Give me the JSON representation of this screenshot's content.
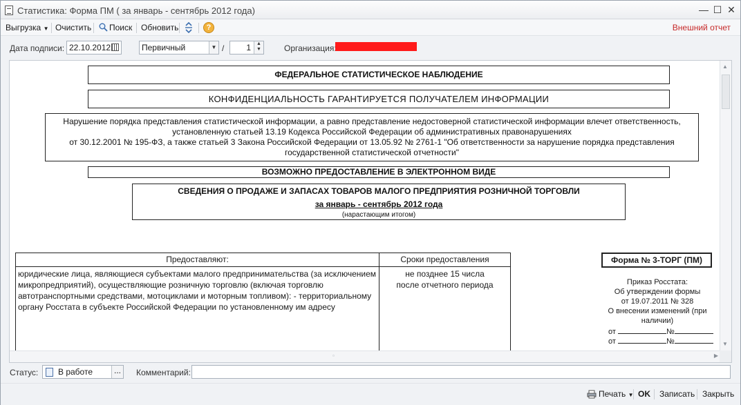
{
  "window": {
    "title": "Статистика: Форма ПМ ( за январь - сентябрь 2012 года)",
    "minimize": "—",
    "maximize": "☐",
    "close": "✕"
  },
  "toolbar": {
    "export_label": "Выгрузка",
    "clear_label": "Очистить",
    "search_label": "Поиск",
    "refresh_label": "Обновить",
    "help_glyph": "?",
    "external_report_label": "Внешний отчет",
    "external_report_color": "#c62828"
  },
  "header": {
    "sign_date_label": "Дата подписи:",
    "sign_date_value": "22.10.2012",
    "report_type_value": "Первичный",
    "slash": "/",
    "correction_value": "1",
    "organization_label": "Организация:"
  },
  "document": {
    "federal_title": "ФЕДЕРАЛЬНОЕ СТАТИСТИЧЕСКОЕ НАБЛЮДЕНИЕ",
    "confidential": "КОНФИДЕНЦИАЛЬНОСТЬ  ГАРАНТИРУЕТСЯ   ПОЛУЧАТЕЛЕМ   ИНФОРМАЦИИ",
    "warning_lines": [
      "Нарушение порядка представления статистической информации, а равно представление недостоверной статистической информации влечет ответственность,",
      "установленную статьей 13.19 Кодекса Российской Федерации об административных правонарушениях",
      "от 30.12.2001 № 195-ФЗ, а также статьей 3 Закона Российской Федерации от 13.05.92 № 2761-1 \"Об ответственности за нарушение порядка представления",
      "государственной статистической отчетности\""
    ],
    "electronic": "ВОЗМОЖНО ПРЕДОСТАВЛЕНИЕ В ЭЛЕКТРОННОМ ВИДЕ",
    "report_title": "СВЕДЕНИЯ О ПРОДАЖЕ И ЗАПАСАХ ТОВАРОВ МАЛОГО ПРЕДПРИЯТИЯ РОЗНИЧНОЙ ТОРГОВЛИ",
    "period": "за январь - сентябрь 2012 года",
    "cumulative": "(нарастающим итогом)",
    "table": {
      "col_who": "Предоставляют:",
      "col_when": "Сроки предоставления",
      "who_text": "юридические лица, являющиеся субъектами малого предпринимательства (за исключением микропредприятий), осуществляющие розничную торговлю (включая торговлю автотранспортными средствами, мотоциклами и моторным топливом): - территориальному органу Росстата в субъекте Российской Федерации по установленному им адресу",
      "when_line1": "не позднее 15 числа",
      "when_line2": "после отчетного периода"
    },
    "form_number": "Форма № 3-ТОРГ (ПМ)",
    "order_lines": [
      "Приказ Росстата:",
      "Об утверждении формы",
      "от 19.07.2011 № 328",
      "О внесении изменений (при",
      "наличии)"
    ],
    "sig_from": "от",
    "sig_no": "№"
  },
  "status": {
    "status_label": "Статус:",
    "status_value": "В работе",
    "status_button": "...",
    "comment_label": "Комментарий:",
    "comment_value": ""
  },
  "buttons": {
    "print_label": "Печать",
    "ok_label": "OK",
    "save_label": "Записать",
    "close_label": "Закрыть"
  },
  "colors": {
    "redaction": "#ff1a1a",
    "help_icon": "#f2b33d"
  }
}
